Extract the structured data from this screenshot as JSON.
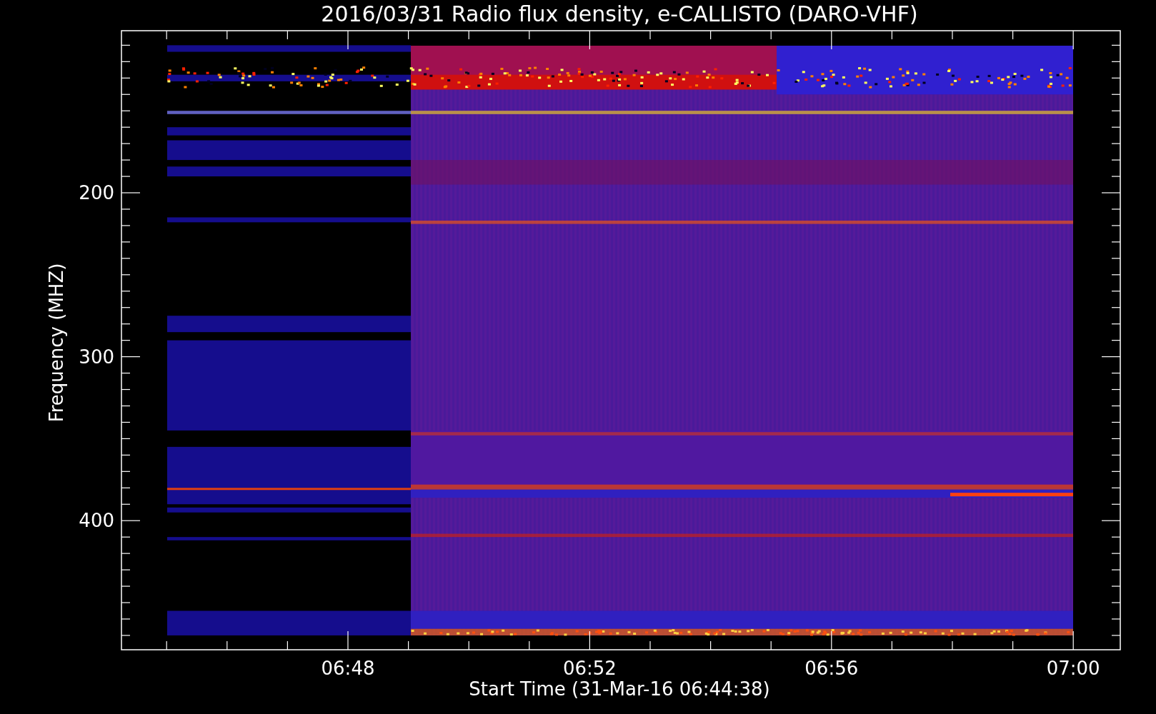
{
  "title": "2016/03/31  Radio flux density, e-CALLISTO (DARO-VHF)",
  "y_axis": {
    "label": "Frequency (MHZ)",
    "ticks": [
      "200",
      "300",
      "400"
    ]
  },
  "x_axis": {
    "label": "Start Time (31-Mar-16 06:44:38)",
    "ticks": [
      "06:48",
      "06:52",
      "06:56",
      "07:00"
    ]
  }
}
